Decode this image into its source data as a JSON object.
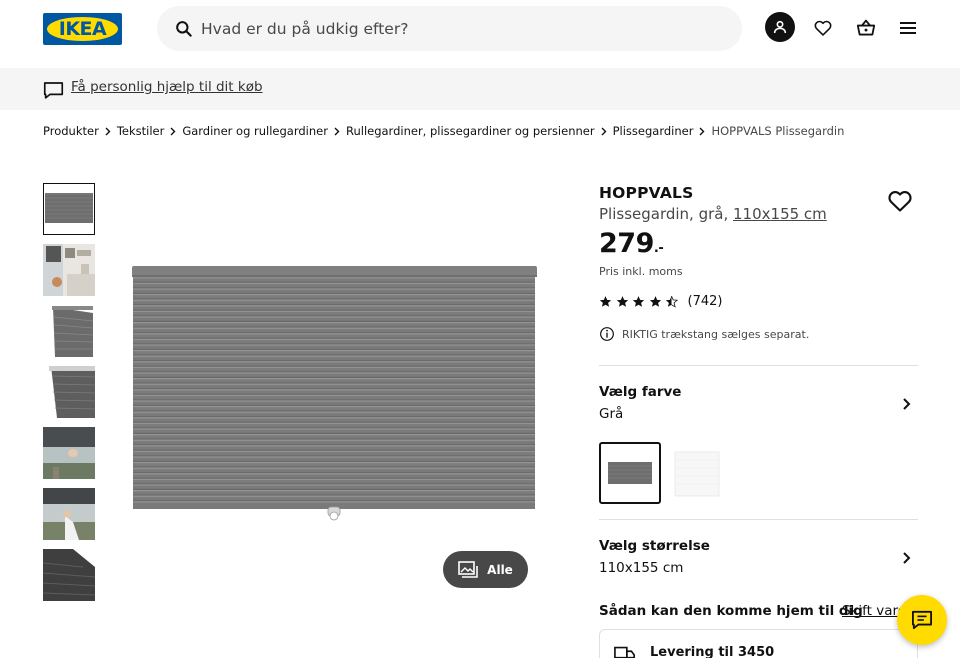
{
  "brand": {
    "logo_text": "IKEA",
    "blue": "#0058a3",
    "yellow": "#ffdb00"
  },
  "header": {
    "search_placeholder": "Hvad er du på udkig efter?",
    "icons": [
      "search-icon",
      "account-icon",
      "heart-icon",
      "basket-icon",
      "hamburger-menu-icon"
    ]
  },
  "help_banner": {
    "label": "Få personlig hjælp til dit køb",
    "icon": "chat-bubble-icon"
  },
  "breadcrumb": [
    "Produkter",
    "Tekstiler",
    "Gardiner og rullegardiner",
    "Rullegardiner, plissegardiner og persienner",
    "Plissegardiner",
    "HOPPVALS Plissegardin"
  ],
  "gallery": {
    "thumbnails": [
      "blind-front",
      "blind-room",
      "blind-side",
      "blind-detail",
      "blind-window-hand",
      "blind-window-raise",
      "blind-closeup"
    ],
    "selected_index": 0,
    "all_button": "Alle"
  },
  "product": {
    "name": "HOPPVALS",
    "description": "Plissegardin, grå, ",
    "size_link": "110x155 cm",
    "price": "279",
    "price_suffix": ".-",
    "vat_note": "Pris inkl. moms",
    "rating": 4.5,
    "rating_count": "(742)",
    "notice": "RIKTIG trækstang sælges separat."
  },
  "color_section": {
    "title": "Vælg farve",
    "value": "Grå",
    "swatches": [
      "grey",
      "white"
    ],
    "selected": 0
  },
  "size_section": {
    "title": "Vælg størrelse",
    "value": "110x155 cm"
  },
  "delivery": {
    "title": "Sådan kan den komme hjem til dig",
    "store_link": "Skift varehus",
    "label": "Levering til 3450"
  }
}
